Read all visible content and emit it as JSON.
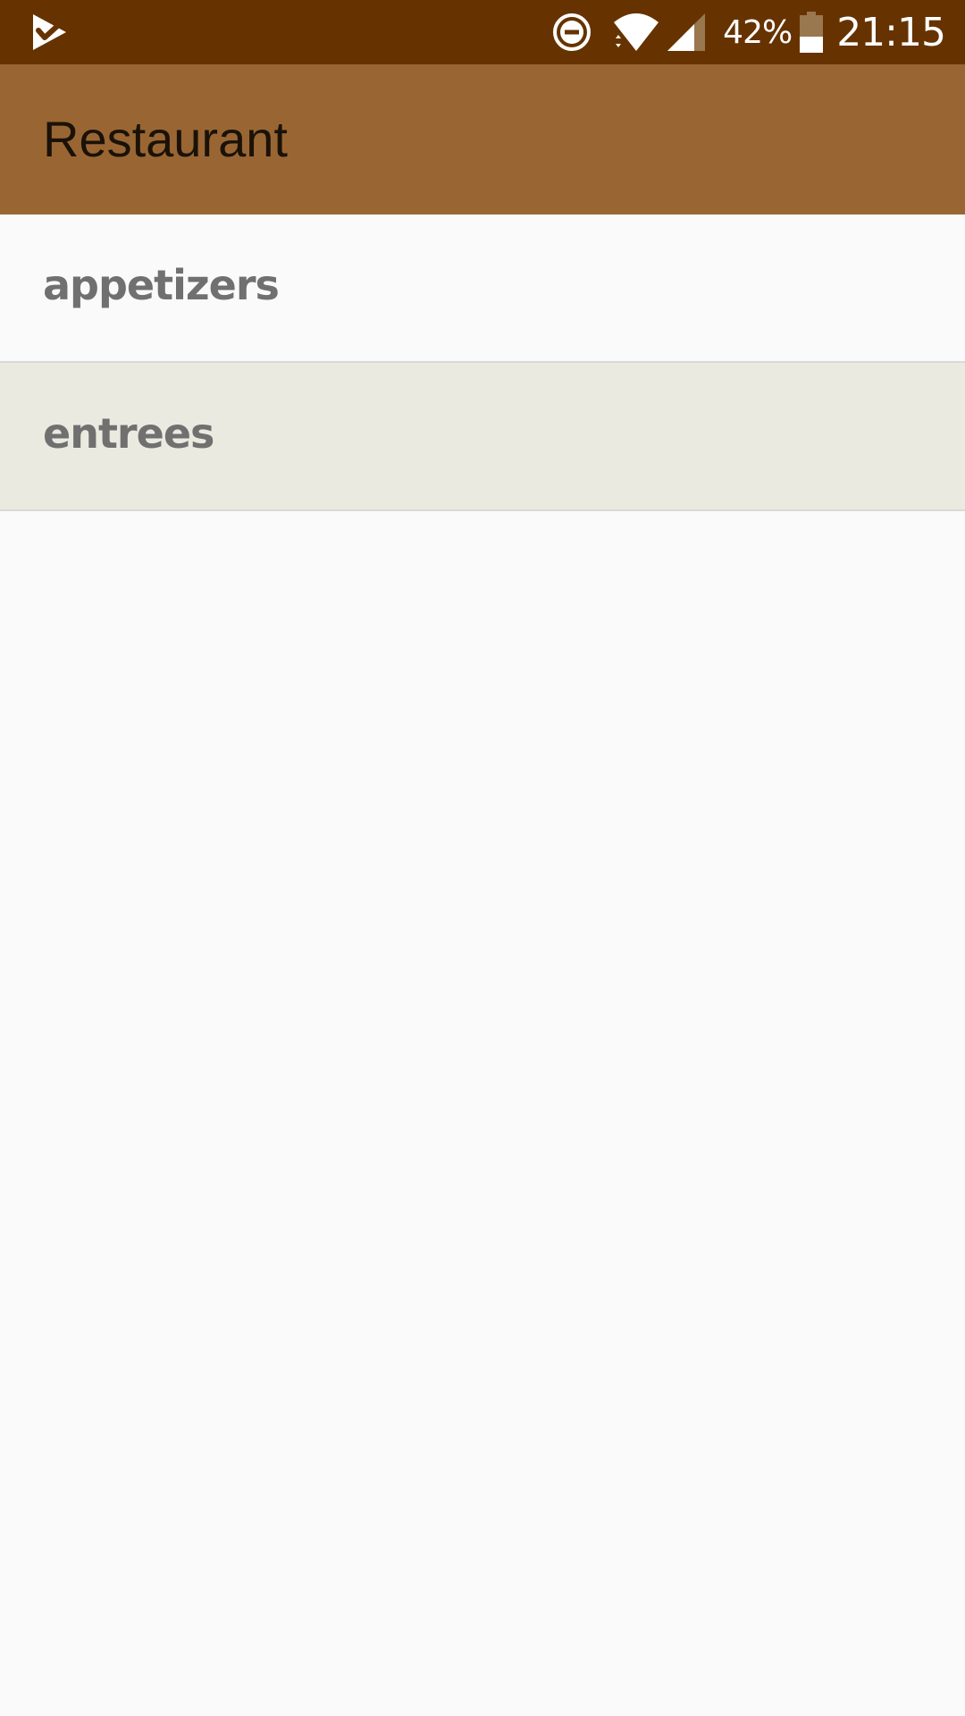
{
  "status_bar": {
    "battery_percent": "42%",
    "time": "21:15",
    "battery_level": 0.42,
    "icons": [
      "task-check-icon",
      "do-not-disturb-icon",
      "wifi-icon",
      "cellular-signal-icon",
      "battery-icon"
    ],
    "background_color": "#663300"
  },
  "app_bar": {
    "title": "Restaurant",
    "background_color": "#996633"
  },
  "categories": [
    {
      "label": "appetizers",
      "selected": false
    },
    {
      "label": "entrees",
      "selected": true
    }
  ],
  "colors": {
    "list_background": "#fafafa",
    "selected_row": "#ebeae0",
    "item_text": "#707070"
  }
}
